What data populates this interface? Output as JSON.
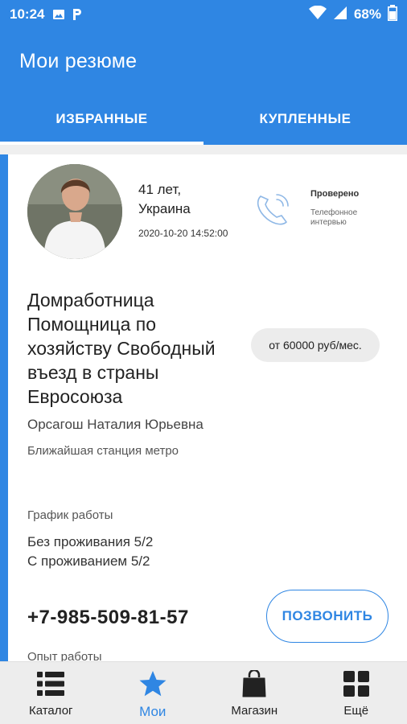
{
  "status_bar": {
    "time": "10:24",
    "battery": "68%"
  },
  "app_bar": {
    "title": "Мои резюме"
  },
  "tabs": [
    {
      "label": "ИЗБРАННЫЕ",
      "active": true
    },
    {
      "label": "КУПЛЕННЫЕ",
      "active": false
    }
  ],
  "card": {
    "age": "41 лет,",
    "country": "Украина",
    "date": "2020-10-20 14:52:00",
    "verified_title": "Проверено",
    "verified_sub": "Телефонное интервью",
    "job_title": "Домработница Помощница по хозяйству Свободный въезд в страны Евросоюза",
    "salary": "от 60000 руб/мес.",
    "full_name": "Орсагош Наталия Юрьевна",
    "metro": "Ближайшая станция метро",
    "schedule_label": "График работы",
    "schedule_1": "Без проживания 5/2",
    "schedule_2": "С проживанием 5/2",
    "phone": "+7-985-509-81-57",
    "call_label": "ПОЗВОНИТЬ",
    "experience_label": "Опыт работы"
  },
  "bottom_nav": [
    {
      "label": "Каталог",
      "icon": "list-icon",
      "active": false
    },
    {
      "label": "Мои",
      "icon": "star-icon",
      "active": true
    },
    {
      "label": "Магазин",
      "icon": "bag-icon",
      "active": false
    },
    {
      "label": "Ещё",
      "icon": "grid-icon",
      "active": false
    }
  ],
  "colors": {
    "primary": "#2f86e3",
    "nav_bg": "#ededed"
  }
}
